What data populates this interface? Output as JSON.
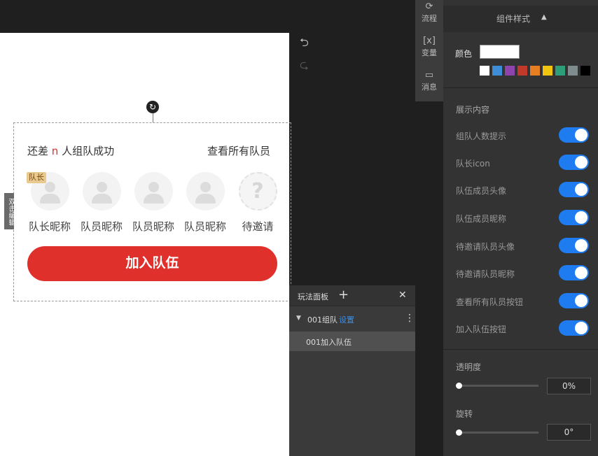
{
  "canvas": {
    "edit_hint": "双击编辑",
    "rotate_icon": "rotate-icon",
    "team": {
      "status_prefix": "还差",
      "status_count": "n",
      "status_suffix": "人组队成功",
      "view_all": "查看所有队员",
      "leader_badge": "队长",
      "members": [
        {
          "name": "队长昵称",
          "state": "filled"
        },
        {
          "name": "队员昵称",
          "state": "filled"
        },
        {
          "name": "队员昵称",
          "state": "filled"
        },
        {
          "name": "队员昵称",
          "state": "filled"
        },
        {
          "name": "待邀请",
          "state": "pending"
        }
      ],
      "pending_glyph": "?",
      "join_button": "加入队伍"
    }
  },
  "history": {
    "undo_icon": "undo-icon",
    "redo_icon": "redo-icon"
  },
  "play_panel": {
    "title": "玩法面板",
    "group_name": "001组队",
    "group_settings": "设置",
    "item": "001加入队伍"
  },
  "tool_strip": [
    {
      "label": "流程",
      "icon": "flow-icon"
    },
    {
      "label": "变量",
      "icon": "variable-icon"
    },
    {
      "label": "消息",
      "icon": "message-icon"
    }
  ],
  "props": {
    "title": "组件样式",
    "color_label": "颜色",
    "color_value": "#ffffff",
    "swatches": [
      "#ffffff",
      "#3d8ed6",
      "#8e44ad",
      "#c0392b",
      "#e67e22",
      "#f1c40f",
      "#2e9e7a",
      "#7f8c8d",
      "#000000"
    ],
    "content_label": "展示内容",
    "toggles": [
      {
        "label": "组队人数提示",
        "on": true
      },
      {
        "label": "队长icon",
        "on": true
      },
      {
        "label": "队伍成员头像",
        "on": true
      },
      {
        "label": "队伍成员昵称",
        "on": true
      },
      {
        "label": "待邀请队员头像",
        "on": true
      },
      {
        "label": "待邀请队员昵称",
        "on": true
      },
      {
        "label": "查看所有队员按钮",
        "on": true
      },
      {
        "label": "加入队伍按钮",
        "on": true
      }
    ],
    "opacity_label": "透明度",
    "opacity_value": "0%",
    "rotation_label": "旋转",
    "rotation_value": "0°",
    "accent": "#1e7cf0"
  }
}
